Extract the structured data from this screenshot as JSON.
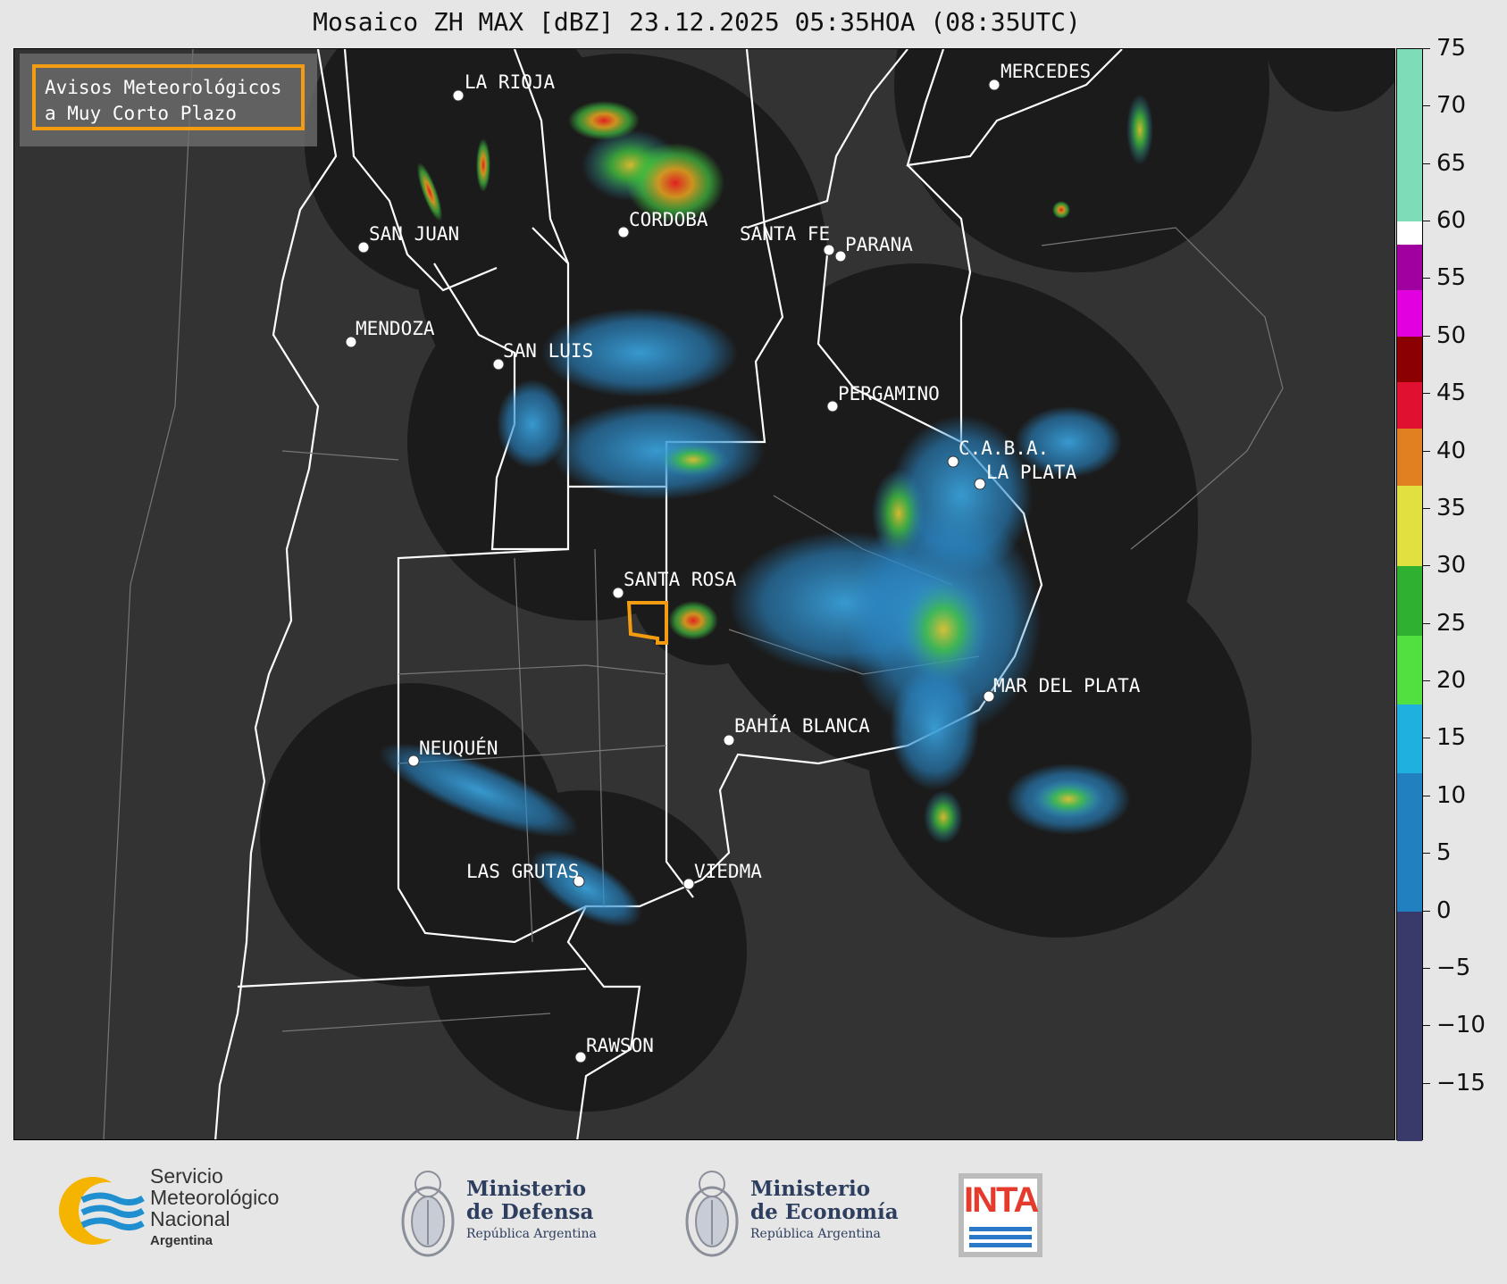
{
  "title": "Mosaico ZH MAX [dBZ] 23.12.2025 05:35HOA (08:35UTC)",
  "avisos": {
    "line1": "Avisos Meteorológicos",
    "line2": "a Muy Corto Plazo"
  },
  "cities": [
    {
      "name": "LA RIOJA"
    },
    {
      "name": "CORDOBA"
    },
    {
      "name": "SAN JUAN"
    },
    {
      "name": "SANTA FE"
    },
    {
      "name": "PARANA"
    },
    {
      "name": "MENDOZA"
    },
    {
      "name": "SAN LUIS"
    },
    {
      "name": "PERGAMINO"
    },
    {
      "name": "C.A.B.A."
    },
    {
      "name": "LA PLATA"
    },
    {
      "name": "MERCEDES"
    },
    {
      "name": "SANTA ROSA"
    },
    {
      "name": "MAR DEL PLATA"
    },
    {
      "name": "BAHÍA BLANCA"
    },
    {
      "name": "NEUQUÉN"
    },
    {
      "name": "LAS GRUTAS"
    },
    {
      "name": "VIEDMA"
    },
    {
      "name": "RAWSON"
    }
  ],
  "colorbar": {
    "ticks": [
      "75",
      "70",
      "65",
      "60",
      "55",
      "50",
      "45",
      "40",
      "35",
      "30",
      "25",
      "20",
      "15",
      "10",
      "5",
      "0",
      "−5",
      "−10",
      "−15"
    ],
    "colors": {
      "high": "#7fdcb8",
      "white": "#ffffff",
      "purple": "#a000a0",
      "magenta": "#e000e0",
      "darkred": "#8b0000",
      "red": "#e01030",
      "orange": "#e08020",
      "yellow": "#e0e040",
      "green": "#30b030",
      "lime": "#50e040",
      "cyan": "#20b0e0",
      "blue": "#2080c0",
      "navy": "#3a3a6a"
    }
  },
  "logos": {
    "smn": {
      "line1": "Servicio",
      "line2": "Meteorológico",
      "line3": "Nacional",
      "line4": "Argentina"
    },
    "defensa": {
      "line1": "Ministerio",
      "line2": "de Defensa",
      "line3": "República Argentina"
    },
    "economia": {
      "line1": "Ministerio",
      "line2": "de Economía",
      "line3": "República Argentina"
    },
    "inta": {
      "text": "INTA"
    }
  }
}
